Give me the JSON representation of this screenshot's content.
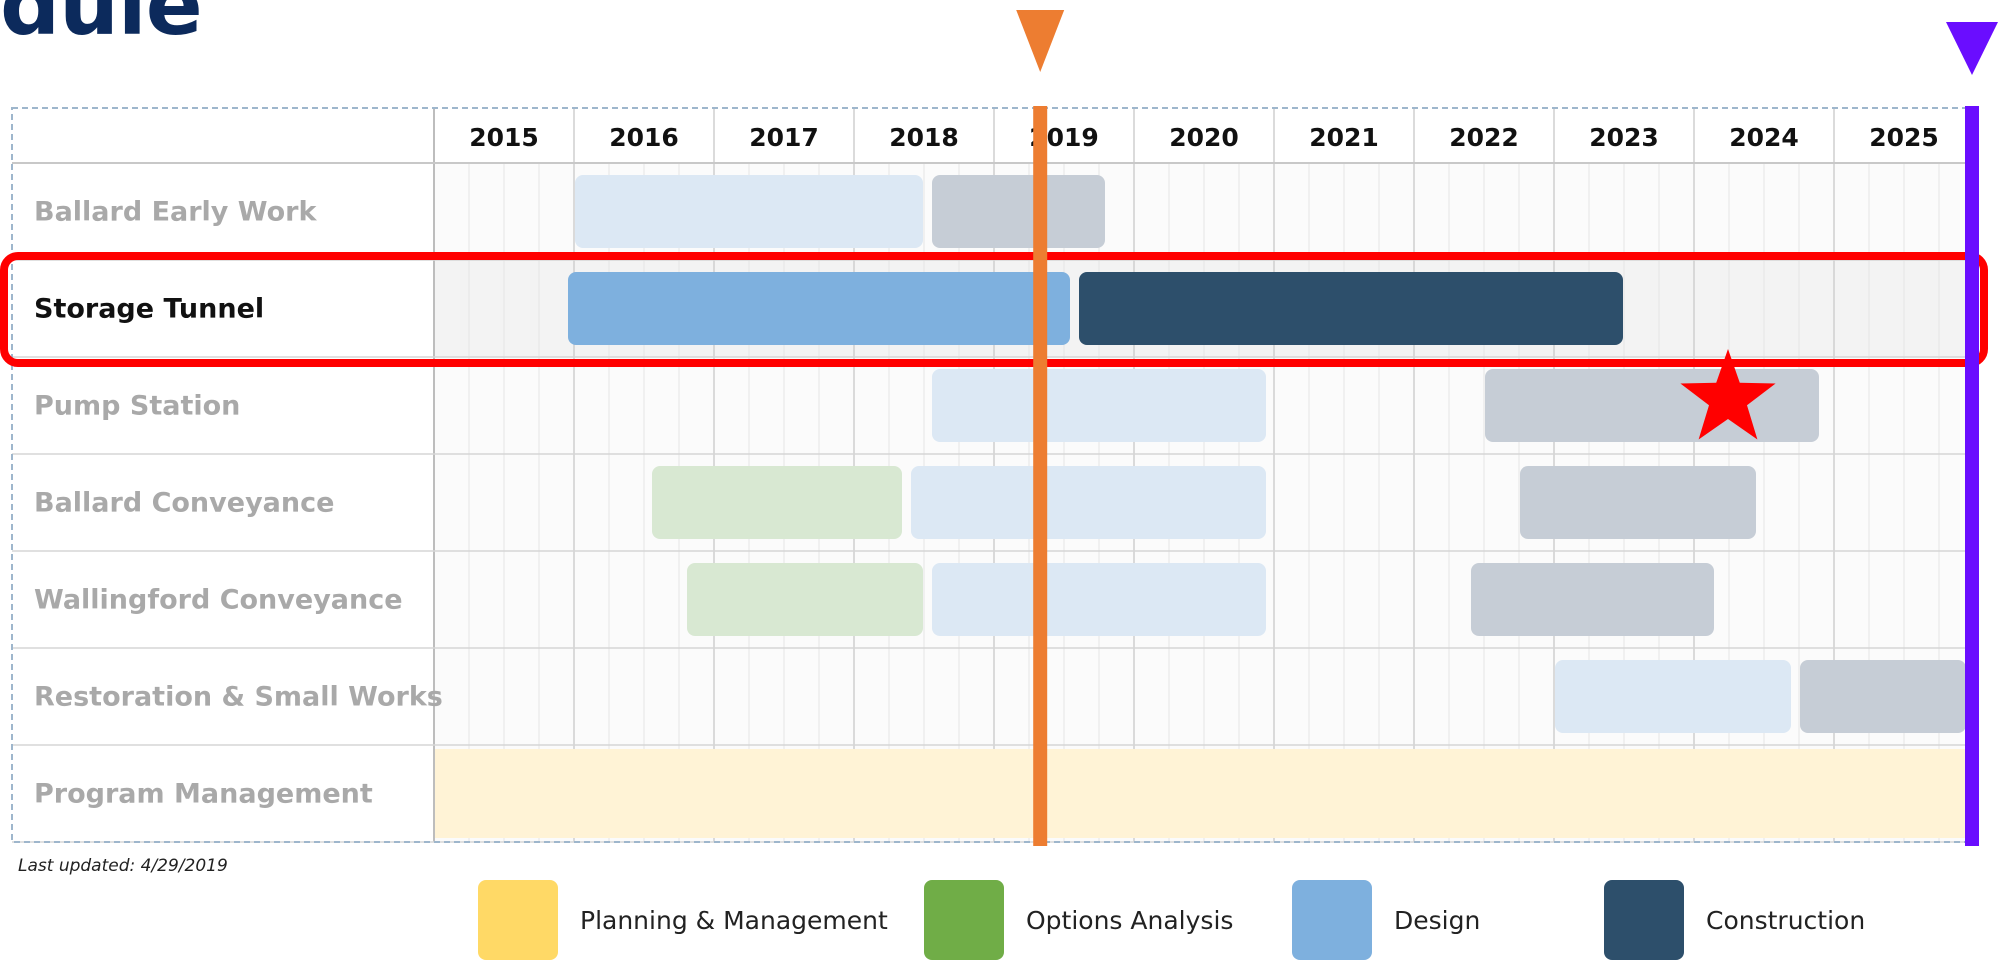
{
  "page": {
    "title": "dule",
    "last_updated": "Last updated: 4/29/2019"
  },
  "colors": {
    "planning": "#ffd966",
    "options": "#70ad47",
    "design": "#7eb0de",
    "construction": "#2d4f6b",
    "highlight": "#ff0000",
    "today_marker": "#ed7d31",
    "end_marker": "#6a0dff"
  },
  "legend": [
    {
      "label": "Planning & Management",
      "color": "#ffd966"
    },
    {
      "label": "Options Analysis",
      "color": "#70ad47"
    },
    {
      "label": "Design",
      "color": "#7eb0de"
    },
    {
      "label": "Construction",
      "color": "#2d4f6b"
    }
  ],
  "chart_data": {
    "type": "gantt",
    "years": [
      "2015",
      "2016",
      "2017",
      "2018",
      "2019",
      "2020",
      "2021",
      "2022",
      "2023",
      "2024",
      "2025"
    ],
    "rows": [
      {
        "label": "Ballard Early Work",
        "faded": true,
        "bars": [
          {
            "phase": "design",
            "start": 2016.0,
            "end": 2018.5
          },
          {
            "phase": "construction",
            "start": 2018.55,
            "end": 2019.8
          }
        ]
      },
      {
        "label": "Storage Tunnel",
        "faded": false,
        "highlighted": true,
        "bars": [
          {
            "phase": "design",
            "start": 2015.95,
            "end": 2019.55
          },
          {
            "phase": "construction",
            "start": 2019.6,
            "end": 2023.5
          }
        ]
      },
      {
        "label": "Pump Station",
        "faded": true,
        "bars": [
          {
            "phase": "design",
            "start": 2018.55,
            "end": 2020.95
          },
          {
            "phase": "construction",
            "start": 2022.5,
            "end": 2024.9
          }
        ]
      },
      {
        "label": "Ballard Conveyance",
        "faded": true,
        "bars": [
          {
            "phase": "options",
            "start": 2016.55,
            "end": 2018.35
          },
          {
            "phase": "design",
            "start": 2018.4,
            "end": 2020.95
          },
          {
            "phase": "construction",
            "start": 2022.75,
            "end": 2024.45
          }
        ]
      },
      {
        "label": "Wallingford Conveyance",
        "faded": true,
        "bars": [
          {
            "phase": "options",
            "start": 2016.8,
            "end": 2018.5
          },
          {
            "phase": "design",
            "start": 2018.55,
            "end": 2020.95
          },
          {
            "phase": "construction",
            "start": 2022.4,
            "end": 2024.15
          }
        ]
      },
      {
        "label": "Restoration & Small Works",
        "faded": true,
        "bars": [
          {
            "phase": "design",
            "start": 2023.0,
            "end": 2024.7
          },
          {
            "phase": "construction",
            "start": 2024.75,
            "end": 2025.95
          }
        ]
      },
      {
        "label": "Program Management",
        "faded": true,
        "bars": [
          {
            "phase": "planning",
            "start": 2015.0,
            "end": 2026.0
          }
        ]
      }
    ],
    "markers": [
      {
        "name": "today",
        "x": 2019.33,
        "color": "#ed7d31"
      },
      {
        "name": "end",
        "x": 2026.0,
        "color": "#6a0dff"
      }
    ],
    "star": {
      "row": "Pump Station",
      "x": 2024.2
    }
  }
}
